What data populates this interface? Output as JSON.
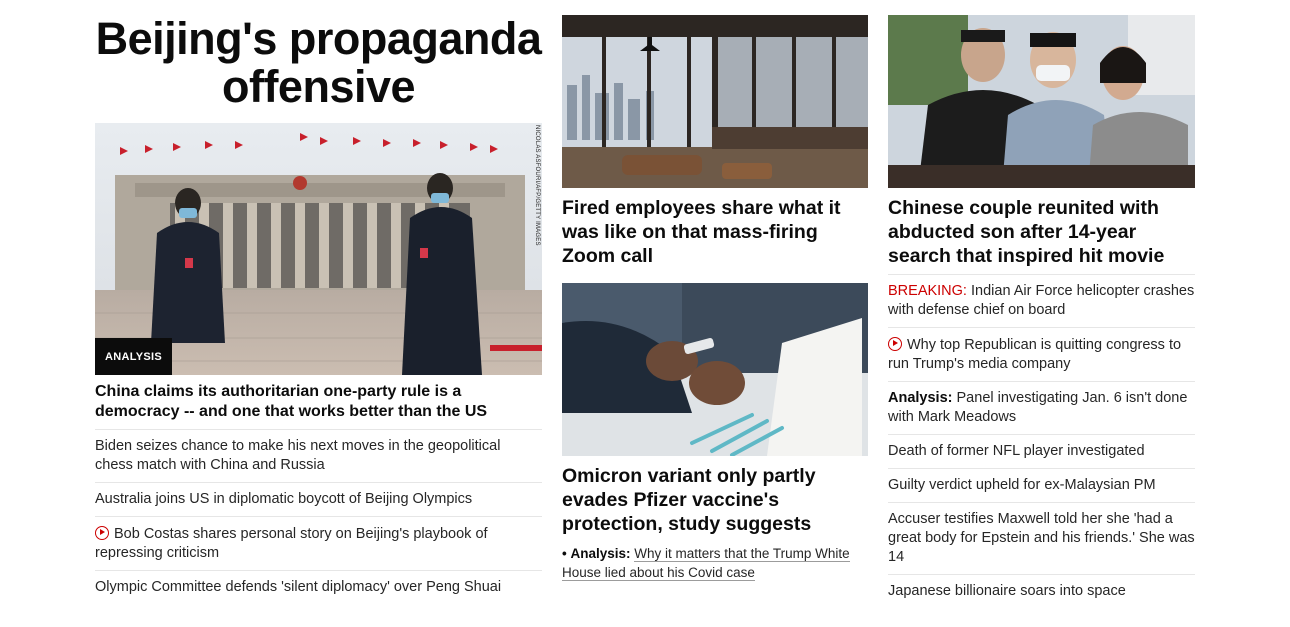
{
  "col1": {
    "section_title": "Beijing's propaganda offensive",
    "hero": {
      "badge": "ANALYSIS",
      "credit": "NICOLAS ASFOURI/AFP/GETTY IMAGES",
      "headline": "China claims its authoritarian one-party rule is a democracy -- and one that works better than the US"
    },
    "items": [
      {
        "text": "Biden seizes chance to make his next moves in the geopolitical chess match with China and Russia"
      },
      {
        "text": "Australia joins US in diplomatic boycott of Beijing Olympics"
      },
      {
        "text": "Bob Costas shares personal story on Beijing's playbook of repressing criticism",
        "icon": "play-icon"
      },
      {
        "text": "Olympic Committee defends 'silent diplomacy' over Peng Shuai"
      }
    ]
  },
  "col2": {
    "card1": {
      "headline": "Fired employees share what it was like on that mass-firing Zoom call"
    },
    "card2": {
      "headline": "Omicron variant only partly evades Pfizer vaccine's protection, study suggests",
      "sub_bullet": "•",
      "sub_label": "Analysis:",
      "sub_text": "Why it matters that the Trump White House lied about his Covid case"
    }
  },
  "col3": {
    "card": {
      "headline": "Chinese couple reunited with abducted son after 14-year search that inspired hit movie"
    },
    "items": [
      {
        "prefix": "BREAKING:",
        "text": "Indian Air Force helicopter crashes with defense chief on board"
      },
      {
        "icon": "play-icon",
        "text": "Why top Republican is quitting congress to run Trump's media company"
      },
      {
        "label": "Analysis:",
        "text": "Panel investigating Jan. 6 isn't done with Mark Meadows"
      },
      {
        "text": "Death of former NFL player investigated"
      },
      {
        "text": "Guilty verdict upheld for ex-Malaysian PM"
      },
      {
        "text": "Accuser testifies Maxwell told her she 'had a great body for Epstein and his friends.' She was 14"
      },
      {
        "text": "Japanese billionaire soars into space"
      }
    ]
  },
  "colors": {
    "breaking": "#cc0000",
    "text": "#0c0c0c",
    "secondary": "#262626",
    "divider": "#e6e6e6"
  }
}
